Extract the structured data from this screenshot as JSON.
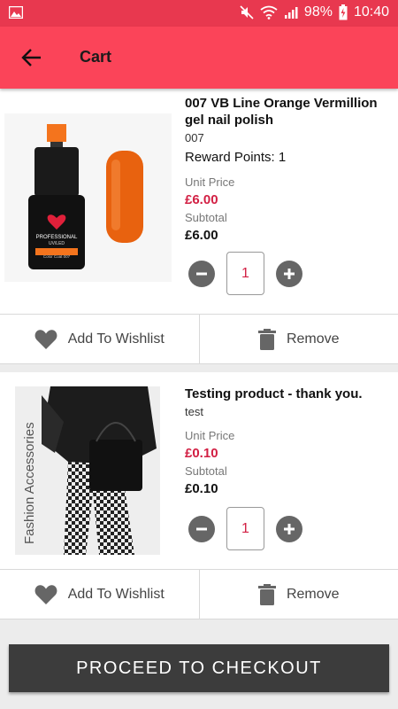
{
  "status_bar": {
    "battery": "98%",
    "time": "10:40",
    "icons": [
      "image-icon",
      "mute-icon",
      "wifi-icon",
      "signal-icon",
      "battery-icon"
    ]
  },
  "app_bar": {
    "title": "Cart",
    "back_icon": "arrow-left-icon",
    "color": "#fb4459"
  },
  "cart_items": [
    {
      "name": "007 VB Line Orange Vermillion gel nail polish",
      "code": "007",
      "reward_points": "Reward Points: 1",
      "unit_price_label": "Unit Price",
      "unit_price": "£6.00",
      "subtotal_label": "Subtotal",
      "subtotal": "£6.00",
      "quantity": "1",
      "image": {
        "label": "PROFESSIONAL",
        "sublabel": "UV/LED",
        "color_code": "Color Coat 007"
      },
      "wishlist_label": "Add To Wishlist",
      "remove_label": "Remove"
    },
    {
      "name": "Testing product - thank you.",
      "code": "test",
      "unit_price_label": "Unit Price",
      "unit_price": "£0.10",
      "subtotal_label": "Subtotal",
      "subtotal": "£0.10",
      "quantity": "1",
      "image": {
        "label": "Fashion Accessories"
      },
      "wishlist_label": "Add To Wishlist",
      "remove_label": "Remove"
    }
  ],
  "checkout_label": "PROCEED TO CHECKOUT",
  "colors": {
    "price": "#d21f43",
    "checkout_bg": "#3c3c3c",
    "status_bar": "#e8384f"
  }
}
